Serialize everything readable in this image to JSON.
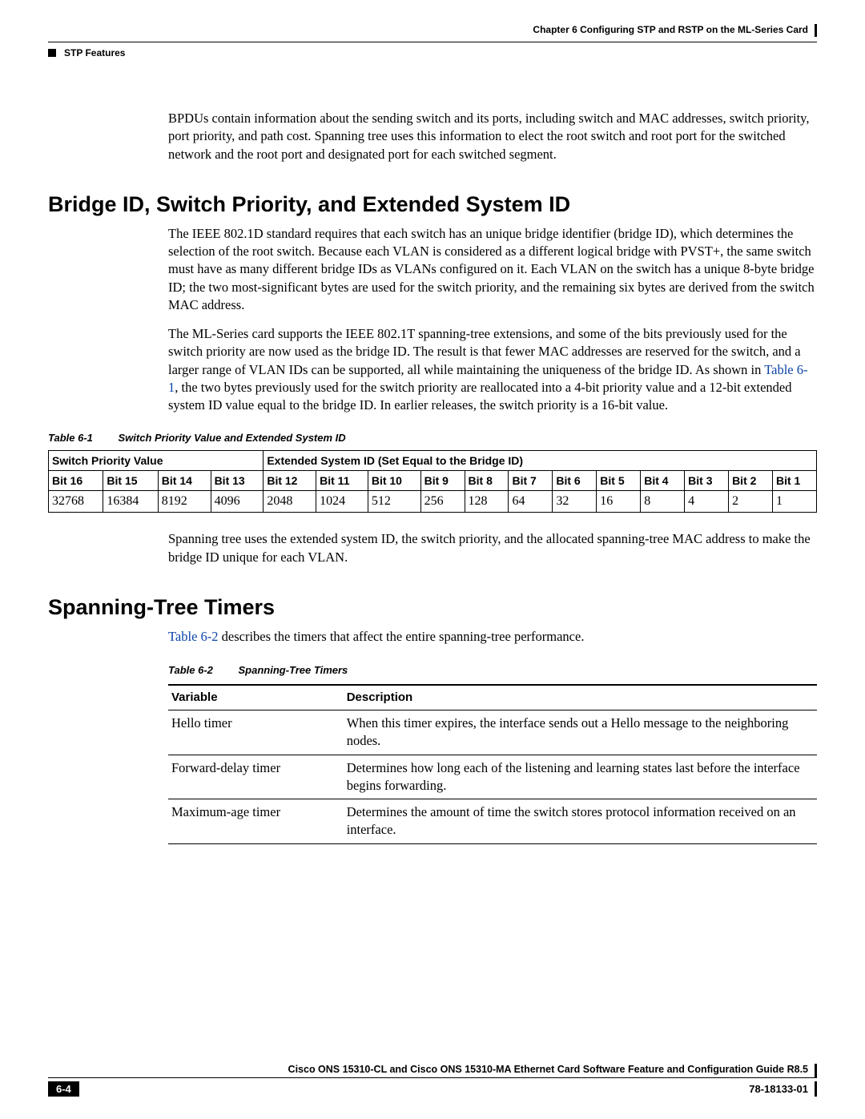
{
  "header": {
    "chapter": "Chapter 6      Configuring STP and RSTP on the ML-Series Card",
    "section": "STP Features"
  },
  "intro_para": "BPDUs contain information about the sending switch and its ports, including switch and MAC addresses, switch priority, port priority, and path cost. Spanning tree uses this information to elect the root switch and root port for the switched network and the root port and designated port for each switched segment.",
  "s1": {
    "title": "Bridge ID, Switch Priority, and Extended System ID",
    "p1": "The IEEE 802.1D standard requires that each switch has an unique bridge identifier (bridge ID), which determines the selection of the root switch. Because each VLAN is considered as a different logical bridge with PVST+, the same switch must have as many different bridge IDs as VLANs configured on it. Each VLAN on the switch has a unique 8-byte bridge ID; the two most-significant bytes are used for the switch priority, and the remaining six bytes are derived from the switch MAC address.",
    "p2a": "The ML-Series card supports the IEEE 802.1T spanning-tree extensions, and some of the bits previously used for the switch priority are now used as the bridge ID. The result is that fewer MAC addresses are reserved for the switch, and a larger range of VLAN IDs can be supported, all while maintaining the uniqueness of the bridge ID. As shown in ",
    "p2_link": "Table 6-1",
    "p2b": ", the two bytes previously used for the switch priority are reallocated into a 4-bit priority value and a 12-bit extended system ID value equal to the bridge ID. In earlier releases, the switch priority is a 16-bit value.",
    "p3": "Spanning tree uses the extended system ID, the switch priority, and the allocated spanning-tree MAC address to make the bridge ID unique for each VLAN."
  },
  "table61": {
    "num": "Table 6-1",
    "title": "Switch Priority Value and Extended System ID",
    "group1": "Switch Priority Value",
    "group2": "Extended System ID (Set Equal to the Bridge ID)",
    "bits": [
      "Bit 16",
      "Bit 15",
      "Bit 14",
      "Bit 13",
      "Bit 12",
      "Bit 11",
      "Bit 10",
      "Bit 9",
      "Bit 8",
      "Bit 7",
      "Bit 6",
      "Bit 5",
      "Bit 4",
      "Bit 3",
      "Bit 2",
      "Bit 1"
    ],
    "vals": [
      "32768",
      "16384",
      "8192",
      "4096",
      "2048",
      "1024",
      "512",
      "256",
      "128",
      "64",
      "32",
      "16",
      "8",
      "4",
      "2",
      "1"
    ]
  },
  "s2": {
    "title": "Spanning-Tree Timers",
    "link": "Table 6-2",
    "p1": " describes the timers that affect the entire spanning-tree performance."
  },
  "table62": {
    "num": "Table 6-2",
    "title": "Spanning-Tree Timers",
    "h1": "Variable",
    "h2": "Description",
    "rows": [
      {
        "v": "Hello timer",
        "d": "When this timer expires, the interface sends out a Hello message to the neighboring nodes."
      },
      {
        "v": "Forward-delay timer",
        "d": "Determines how long each of the listening and learning states last before the interface begins forwarding."
      },
      {
        "v": "Maximum-age timer",
        "d": "Determines the amount of time the switch stores protocol information received on an interface."
      }
    ]
  },
  "footer": {
    "guide": "Cisco ONS 15310-CL and Cisco ONS 15310-MA Ethernet Card Software Feature and Configuration Guide R8.5",
    "page": "6-4",
    "docid": "78-18133-01"
  }
}
